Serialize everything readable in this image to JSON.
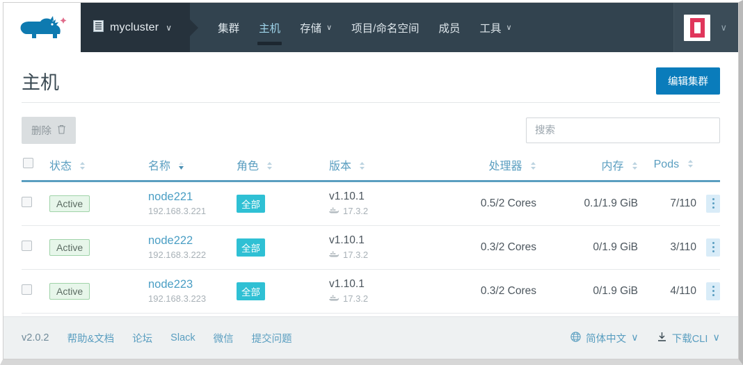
{
  "nav": {
    "logo_icon": "rhino-logo",
    "cluster": {
      "icon": "server-list-icon",
      "name": "mycluster",
      "chevron": "∨"
    },
    "items": [
      {
        "label": "集群",
        "icon": null,
        "active": false
      },
      {
        "label": "主机",
        "icon": null,
        "active": true
      },
      {
        "label": "存储",
        "icon": "chevron-down-icon",
        "active": false
      },
      {
        "label": "项目/命名空间",
        "icon": null,
        "active": false
      },
      {
        "label": "成员",
        "icon": null,
        "active": false
      },
      {
        "label": "工具",
        "icon": "chevron-down-icon",
        "active": false
      }
    ],
    "user": {
      "avatar_icon": "user-avatar",
      "chevron": "∨"
    }
  },
  "header": {
    "title": "主机",
    "edit_cluster_label": "编辑集群"
  },
  "toolbar": {
    "delete_label": "删除",
    "delete_icon": "trash-icon",
    "search_placeholder": "搜索",
    "search_value": ""
  },
  "table": {
    "columns": [
      {
        "key": "state",
        "label": "状态",
        "sorted": false
      },
      {
        "key": "name",
        "label": "名称",
        "sorted": true
      },
      {
        "key": "role",
        "label": "角色",
        "sorted": false
      },
      {
        "key": "version",
        "label": "版本",
        "sorted": false
      },
      {
        "key": "cpu",
        "label": "处理器",
        "sorted": false
      },
      {
        "key": "memory",
        "label": "内存",
        "sorted": false
      },
      {
        "key": "pods",
        "label": "Pods",
        "sorted": false
      }
    ],
    "rows": [
      {
        "selected": false,
        "state": "Active",
        "name": "node221",
        "ip": "192.168.3.221",
        "role": "全部",
        "version": "v1.10.1",
        "docker_version": "17.3.2",
        "docker_icon": "docker-whale-icon",
        "cpu": "0.5/2 Cores",
        "memory": "0.1/1.9 GiB",
        "pods": "7/110",
        "menu_icon": "kebab-menu-icon"
      },
      {
        "selected": false,
        "state": "Active",
        "name": "node222",
        "ip": "192.168.3.222",
        "role": "全部",
        "version": "v1.10.1",
        "docker_version": "17.3.2",
        "docker_icon": "docker-whale-icon",
        "cpu": "0.3/2 Cores",
        "memory": "0/1.9 GiB",
        "pods": "3/110",
        "menu_icon": "kebab-menu-icon"
      },
      {
        "selected": false,
        "state": "Active",
        "name": "node223",
        "ip": "192.168.3.223",
        "role": "全部",
        "version": "v1.10.1",
        "docker_version": "17.3.2",
        "docker_icon": "docker-whale-icon",
        "cpu": "0.3/2 Cores",
        "memory": "0/1.9 GiB",
        "pods": "4/110",
        "menu_icon": "kebab-menu-icon"
      }
    ]
  },
  "footer": {
    "version": "v2.0.2",
    "links": [
      "帮助&文档",
      "论坛",
      "Slack",
      "微信",
      "提交问题"
    ],
    "language": {
      "icon": "globe-icon",
      "label": "简体中文",
      "chevron": "∨"
    },
    "download_cli": {
      "icon": "download-icon",
      "label": "下载CLI",
      "chevron": "∨"
    }
  },
  "colors": {
    "nav_bg": "#32434f",
    "nav_bg_dark": "#26323c",
    "accent_blue": "#0a7cbb",
    "link_blue": "#5a9ec0",
    "badge_green_bg": "#e7f6ea",
    "badge_role_bg": "#2fc0d4",
    "footer_bg": "#eef1f2"
  }
}
